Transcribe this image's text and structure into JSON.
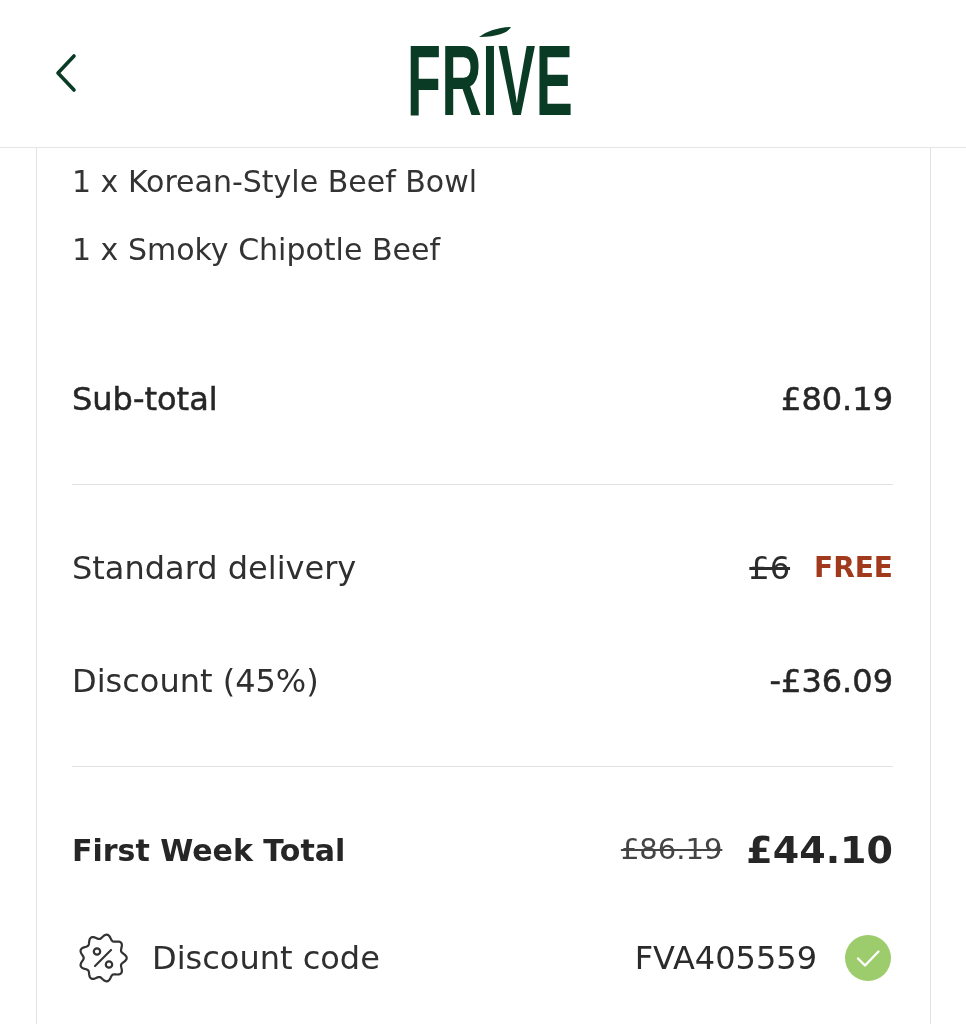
{
  "header": {
    "logo": "FRIVE"
  },
  "order_items": [
    "1 x Korean-Style Beef Bowl",
    "1 x Smoky Chipotle Beef"
  ],
  "summary_groups": [
    {
      "rows": [
        {
          "kind": "subtotal",
          "label": "Sub-total",
          "value": "£80.19"
        }
      ]
    },
    {
      "rows": [
        {
          "kind": "line",
          "label": "Standard delivery",
          "was": "£6",
          "value": "FREE",
          "highlight": true
        },
        {
          "kind": "line",
          "label": "Discount (45%)",
          "value": "-£36.09",
          "highlight": false
        }
      ]
    },
    {
      "rows": [
        {
          "kind": "total",
          "label": "First Week Total",
          "was": "£86.19",
          "value": "£44.10"
        },
        {
          "kind": "code",
          "label": "Discount code",
          "value": "FVA405559",
          "valid": true
        }
      ]
    }
  ]
}
